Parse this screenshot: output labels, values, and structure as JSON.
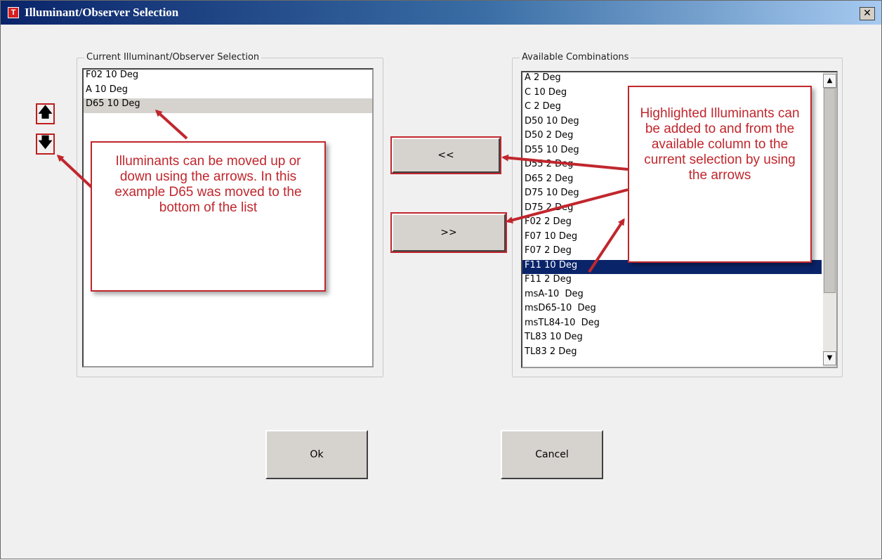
{
  "window": {
    "title": "Illuminant/Observer Selection",
    "icon_letter": "T",
    "close_glyph": "✕"
  },
  "current_group": {
    "legend": "Current Illuminant/Observer Selection",
    "items": [
      "F02 10 Deg",
      "A 10 Deg",
      "D65 10 Deg"
    ],
    "selected": "D65 10 Deg"
  },
  "available_group": {
    "legend": "Available Combinations",
    "items": [
      "A 2 Deg",
      "C 10 Deg",
      "C 2 Deg",
      "D50 10 Deg",
      "D50 2 Deg",
      "D55 10 Deg",
      "D55 2 Deg",
      "D65 2 Deg",
      "D75 10 Deg",
      "D75 2 Deg",
      "F02 2 Deg",
      "F07 10 Deg",
      "F07 2 Deg",
      "F11 10 Deg",
      "F11 2 Deg",
      "msA-10  Deg",
      "msD65-10  Deg",
      "msTL84-10  Deg",
      "TL83 10 Deg",
      "TL83 2 Deg"
    ],
    "selected": "F11 10 Deg"
  },
  "buttons": {
    "add_left": "<<",
    "add_right": ">>",
    "ok": "Ok",
    "cancel": "Cancel",
    "move_up_glyph": "🡅",
    "move_down_glyph": "🡇"
  },
  "scroll": {
    "up_glyph": "▲",
    "down_glyph": "▼"
  },
  "callouts": {
    "left_text": "Illuminants can be moved up or down using the arrows. In this example D65 was moved to the bottom of the list",
    "right_text": "Highlighted Illuminants can be added to and from the available column to the current selection by using the arrows"
  },
  "colors": {
    "annotation_red": "#c0272d",
    "selection_blue": "#0a246a",
    "selection_gray": "#d6d3ce"
  }
}
